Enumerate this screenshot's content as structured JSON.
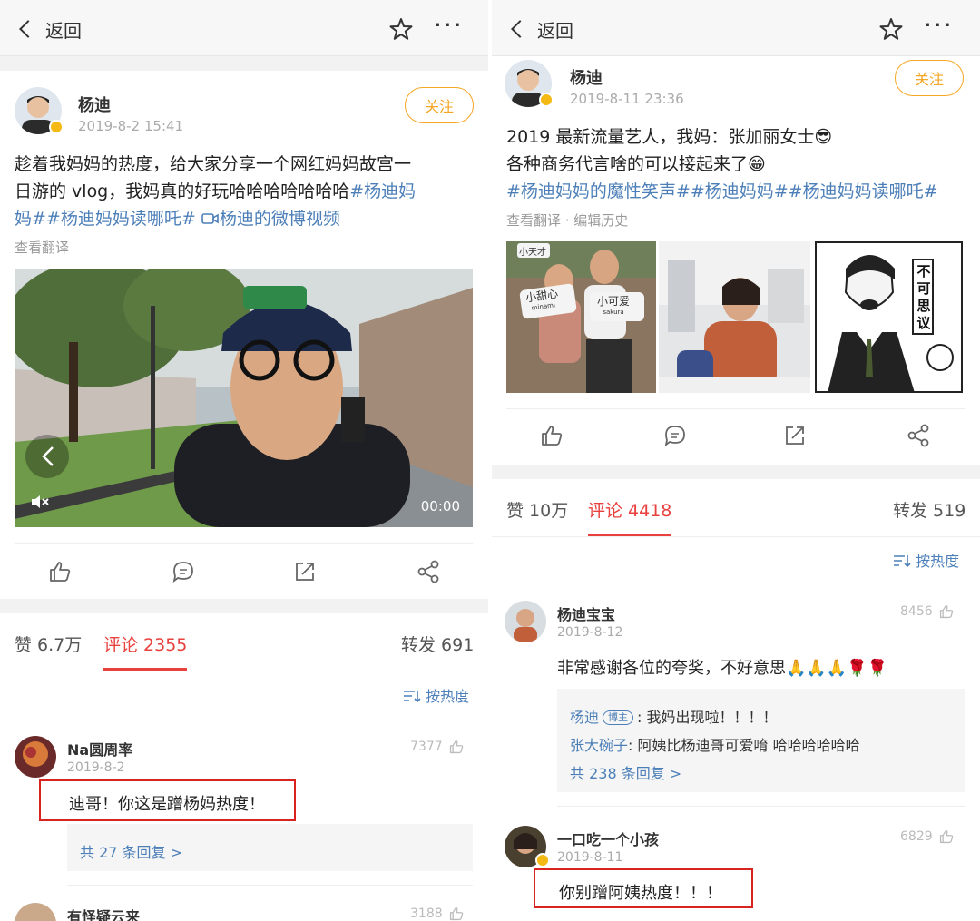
{
  "left": {
    "topbar": {
      "back_label": "返回"
    },
    "post": {
      "author": "杨迪",
      "time": "2019-8-2 15:41",
      "follow_label": "关注",
      "text_line1": "趁着我妈妈的热度，给大家分享一个网红妈妈故宫一",
      "text_line2_plain": "日游的 vlog，我妈真的好玩哈哈哈哈哈哈哈",
      "text_line2_tag": "#杨迪妈",
      "text_line3_tag1": "妈##杨迪妈妈读哪吒#",
      "text_line3_tag2": "杨迪的微博视频",
      "translate_label": "查看翻译",
      "video_time": "00:00"
    },
    "stats": {
      "likes_label": "赞 6.7万",
      "comments_label": "评论 2355",
      "reposts_label": "转发 691"
    },
    "sort_label": "按热度",
    "comments": [
      {
        "name": "Na圆周率",
        "time": "2019-8-2",
        "likes": "7377",
        "text": "迪哥！你这是蹭杨妈热度！",
        "replies_label": "共 27 条回复 >"
      },
      {
        "name": "有怪疑云来",
        "likes": "3188"
      }
    ]
  },
  "right": {
    "topbar": {
      "back_label": "返回"
    },
    "post": {
      "author": "杨迪",
      "time": "2019-8-11 23:36",
      "follow_label": "关注",
      "text_line1": "2019 最新流量艺人，我妈：张加丽女士",
      "text_line2": "各种商务代言啥的可以接起来了",
      "text_line3_tag": "#杨迪妈妈的魔性笑声##杨迪妈妈##杨迪妈妈读哪吒#",
      "translate_label": "查看翻译 · 编辑历史",
      "img1_sign_left": "小甜心",
      "img1_sign_left_sub": "minami",
      "img1_sign_right": "小可爱",
      "img1_sign_right_sub": "sakura",
      "img1_small_sign": "小天才",
      "img3_text": "不可思议"
    },
    "stats": {
      "likes_label": "赞 10万",
      "comments_label": "评论 4418",
      "reposts_label": "转发 519"
    },
    "sort_label": "按热度",
    "comments": [
      {
        "name": "杨迪宝宝",
        "time": "2019-8-12",
        "likes": "8456",
        "text": "非常感谢各位的夸奖，不好意思🙏🙏🙏🌹🌹",
        "replies": [
          {
            "name": "杨迪",
            "badge": "博主",
            "text": ": 我妈出现啦！！！！"
          },
          {
            "name": "张大碗子",
            "text": ": 阿姨比杨迪哥可爱唷 哈哈哈哈哈哈"
          }
        ],
        "replies_label": "共 238 条回复 >"
      },
      {
        "name": "一口吃一个小孩",
        "time": "2019-8-11",
        "likes": "6829",
        "text": "你别蹭阿姨热度！！！"
      }
    ]
  },
  "colors": {
    "accent": "#e8413e",
    "link": "#4c7fb8",
    "follow": "#f5a623",
    "highlight": "#d9231e"
  },
  "icons": [
    "back-chevron-icon",
    "star-icon",
    "more-icon",
    "like-icon",
    "comment-icon",
    "repost-icon",
    "share-icon",
    "sort-icon",
    "mute-icon",
    "verified-badge-icon"
  ]
}
